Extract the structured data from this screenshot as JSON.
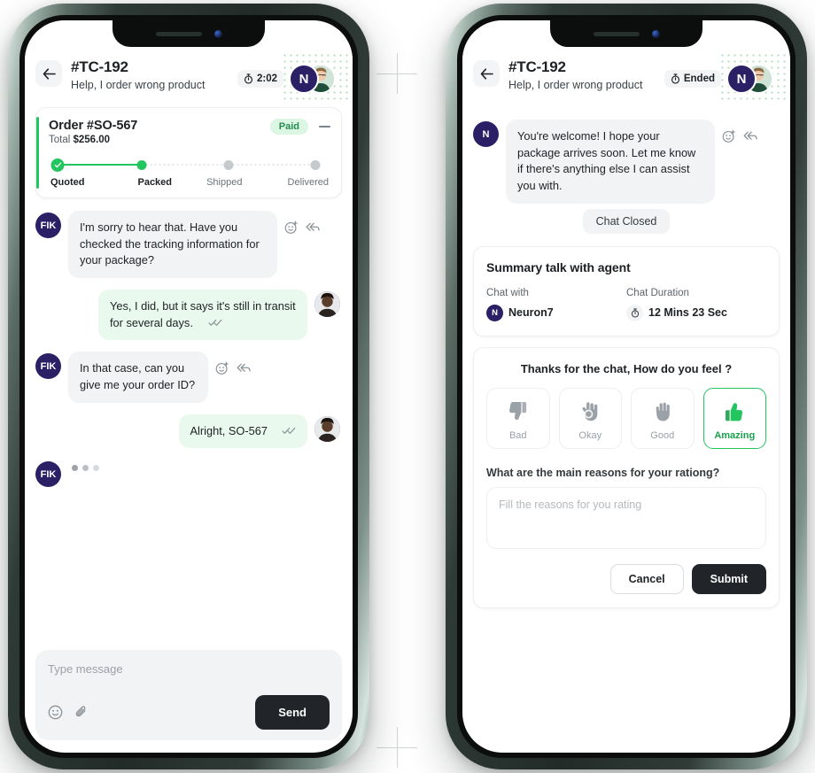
{
  "left_phone": {
    "header": {
      "back_icon": "arrow-left-icon",
      "ticket_id": "#TC-192",
      "ticket_subject": "Help, I order wrong product",
      "status_icon": "stopwatch-icon",
      "status_text": "2:02",
      "agent_initial": "N"
    },
    "order_card": {
      "title": "Order #SO-567",
      "total_label": "Total",
      "total_value": "$256.00",
      "badge": "Paid",
      "collapse_icon": "minus-icon",
      "tracker": {
        "steps": [
          "Quoted",
          "Packed",
          "Shipped",
          "Delivered"
        ],
        "current_index": 1
      }
    },
    "messages": [
      {
        "side": "in",
        "avatar": "FIK",
        "text": "I'm sorry to hear that. Have you checked the tracking information for your package?",
        "has_actions": true
      },
      {
        "side": "out",
        "text": "Yes, I did, but it says it's still in transit for several days.",
        "read": true
      },
      {
        "side": "in",
        "avatar": "FIK",
        "text": "In that case, can you give me your order ID?",
        "has_actions": true
      },
      {
        "side": "out",
        "text": "Alright, SO-567",
        "read": true,
        "inline": true
      },
      {
        "side": "typing",
        "avatar": "FIK"
      }
    ],
    "composer": {
      "placeholder": "Type message",
      "emoji_icon": "emoji-icon",
      "attach_icon": "paperclip-icon",
      "send_label": "Send"
    }
  },
  "right_phone": {
    "header": {
      "back_icon": "arrow-left-icon",
      "ticket_id": "#TC-192",
      "ticket_subject": "Help, I order wrong product",
      "status_icon": "stopwatch-icon",
      "status_text": "Ended",
      "agent_initial": "N"
    },
    "messages": [
      {
        "side": "in",
        "avatar": "N",
        "text": "You're welcome! I hope your package arrives soon. Let me know if there's anything else I can assist you with.",
        "has_actions": true
      }
    ],
    "chat_closed_label": "Chat Closed",
    "summary": {
      "title": "Summary talk with agent",
      "chat_with_label": "Chat with",
      "chat_with_value": "Neuron7",
      "chat_with_initial": "N",
      "duration_label": "Chat Duration",
      "duration_value": "12 Mins 23 Sec",
      "duration_icon": "stopwatch-icon"
    },
    "rating": {
      "question": "Thanks for the chat, How do you feel ?",
      "options": [
        {
          "label": "Bad",
          "icon": "thumbs-down-icon",
          "selected": false
        },
        {
          "label": "Okay",
          "icon": "ok-hand-icon",
          "selected": false
        },
        {
          "label": "Good",
          "icon": "raised-hand-icon",
          "selected": false
        },
        {
          "label": "Amazing",
          "icon": "thumbs-up-icon",
          "selected": true
        }
      ],
      "reason_label": "What are the main reasons for your rationg?",
      "reason_placeholder": "Fill the reasons for you rating",
      "cancel_label": "Cancel",
      "submit_label": "Submit"
    }
  },
  "colors": {
    "accent_green": "#22c55e",
    "dark_button": "#212529",
    "avatar_navy": "#2b1f66",
    "bubble_in": "#f2f3f5",
    "bubble_out": "#e9f9ee"
  }
}
